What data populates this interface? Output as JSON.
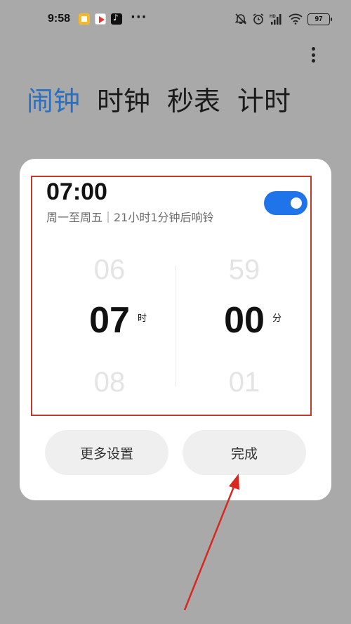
{
  "status_bar": {
    "time": "9:58",
    "more": "···",
    "battery": "97",
    "icons": [
      "notification-app-icon",
      "video-app-icon",
      "tiktok-icon",
      "mute-icon",
      "alarm-clock-icon",
      "hd-signal-icon",
      "wifi-icon",
      "battery-icon"
    ]
  },
  "tabs": [
    {
      "label": "闹钟",
      "active": true
    },
    {
      "label": "时钟",
      "active": false
    },
    {
      "label": "秒表",
      "active": false
    },
    {
      "label": "计时",
      "active": false
    }
  ],
  "alarm": {
    "time": "07:00",
    "subtitle": "周一至周五｜21小时1分钟后响铃",
    "enabled": true
  },
  "picker": {
    "hours": {
      "prev": "06",
      "current": "07",
      "next": "08",
      "unit": "时"
    },
    "minutes": {
      "prev": "59",
      "current": "00",
      "next": "01",
      "unit": "分"
    }
  },
  "buttons": {
    "more_settings": "更多设置",
    "done": "完成"
  },
  "colors": {
    "accent": "#2b6fc0",
    "toggle": "#1e74e8",
    "highlight_box": "#c0392b",
    "arrow": "#d9281f",
    "overlay": "#a9a9a9"
  }
}
